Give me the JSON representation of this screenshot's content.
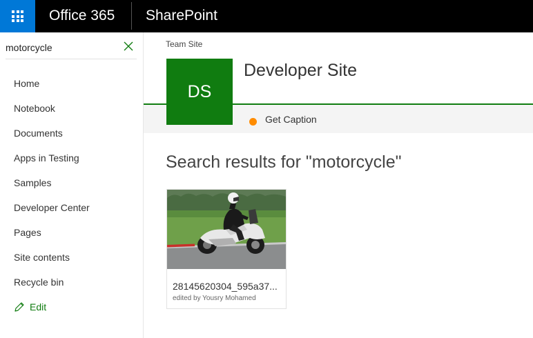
{
  "suitebar": {
    "brand": "Office 365",
    "app": "SharePoint",
    "waffle_icon": "waffle-icon",
    "bg_color": "#000000",
    "waffle_color": "#0078d7"
  },
  "search": {
    "value": "motorcycle",
    "clear_icon": "close-icon"
  },
  "nav": {
    "items": [
      {
        "label": "Home"
      },
      {
        "label": "Notebook"
      },
      {
        "label": "Documents"
      },
      {
        "label": "Apps in Testing"
      },
      {
        "label": "Samples"
      },
      {
        "label": "Developer Center"
      },
      {
        "label": "Pages"
      },
      {
        "label": "Site contents"
      },
      {
        "label": "Recycle bin"
      }
    ],
    "edit_label": "Edit",
    "edit_icon": "pencil-icon"
  },
  "site": {
    "breadcrumb": "Team Site",
    "logo_text": "DS",
    "title": "Developer Site",
    "accent_color": "#107c10"
  },
  "caption": {
    "label": "Get Caption",
    "dot_color": "#ff8c00"
  },
  "results": {
    "heading": "Search results for \"motorcycle\"",
    "items": [
      {
        "title": "28145620304_595a37...",
        "meta": "edited by Yousry Mohamed",
        "thumbnail_icon": "motorcycle-photo"
      }
    ]
  }
}
